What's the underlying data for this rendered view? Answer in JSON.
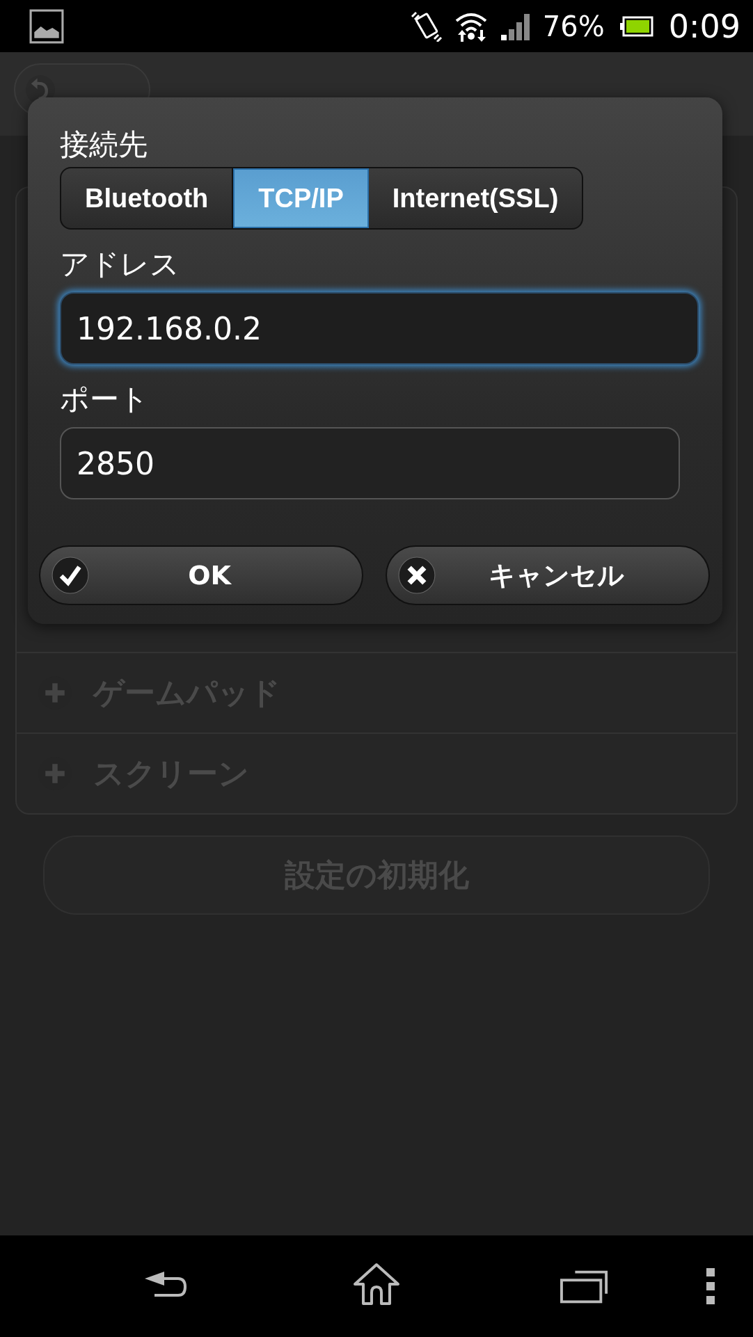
{
  "status_bar": {
    "battery": "76%",
    "time": "0:09"
  },
  "list_items": [
    {
      "label": "ゲームパッド"
    },
    {
      "label": "スクリーン"
    }
  ],
  "reset_button": "設定の初期化",
  "dialog": {
    "connection_label": "接続先",
    "segments": [
      {
        "label": "Bluetooth",
        "selected": false
      },
      {
        "label": "TCP/IP",
        "selected": true
      },
      {
        "label": "Internet(SSL)",
        "selected": false
      }
    ],
    "fields": [
      {
        "label": "アドレス",
        "value": "192.168.0.2",
        "focused": true
      },
      {
        "label": "ポート",
        "value": "2850",
        "focused": false
      }
    ],
    "buttons": [
      {
        "label": "OK",
        "kind": "ok"
      },
      {
        "label": "キャンセル",
        "kind": "cancel"
      }
    ]
  }
}
